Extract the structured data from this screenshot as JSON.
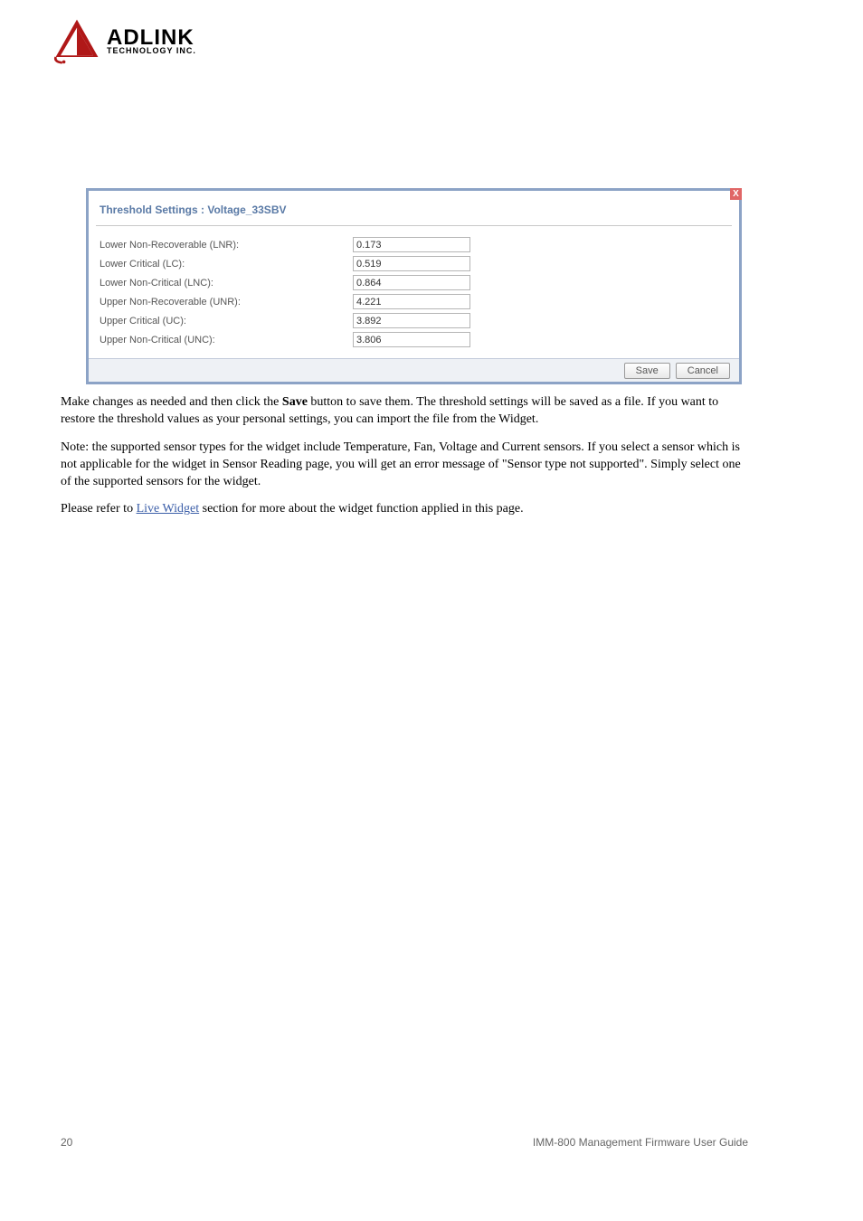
{
  "logo": {
    "main": "ADLINK",
    "sub": "TECHNOLOGY INC."
  },
  "dialog": {
    "title": "Threshold Settings : Voltage_33SBV",
    "close_glyph": "X",
    "fields": [
      {
        "label": "Lower Non-Recoverable (LNR):",
        "value": "0.173"
      },
      {
        "label": "Lower Critical (LC):",
        "value": "0.519"
      },
      {
        "label": "Lower Non-Critical (LNC):",
        "value": "0.864"
      },
      {
        "label": "Upper Non-Recoverable (UNR):",
        "value": "4.221"
      },
      {
        "label": "Upper Critical (UC):",
        "value": "3.892"
      },
      {
        "label": "Upper Non-Critical (UNC):",
        "value": "3.806"
      }
    ],
    "save_label": "Save",
    "cancel_label": "Cancel"
  },
  "paragraphs": {
    "p1_pre": "Make changes as needed and then click the ",
    "p1_strong": "Save",
    "p1_post": " button to save them. The threshold settings will be saved as a file. If you want to restore the threshold values as your personal settings, you can import the file from the Widget.",
    "p2_a": "Note: the supported sensor types for the widget include Temperature, Fan, Voltage and Current sensors. If you select a sensor which is not applicable for the widget in Sensor Reading page, you will get an error message of ",
    "p2_quote": "\"Sensor type not supported\"",
    "p2_b": ". Simply select one of the supported sensors for the widget.",
    "p3_a": "Please refer to ",
    "p3_link": "Live Widget",
    "p3_b": " section for more about the widget function applied in this page."
  },
  "footer": {
    "page": "20",
    "doc": "IMM-800 Management Firmware User Guide"
  }
}
